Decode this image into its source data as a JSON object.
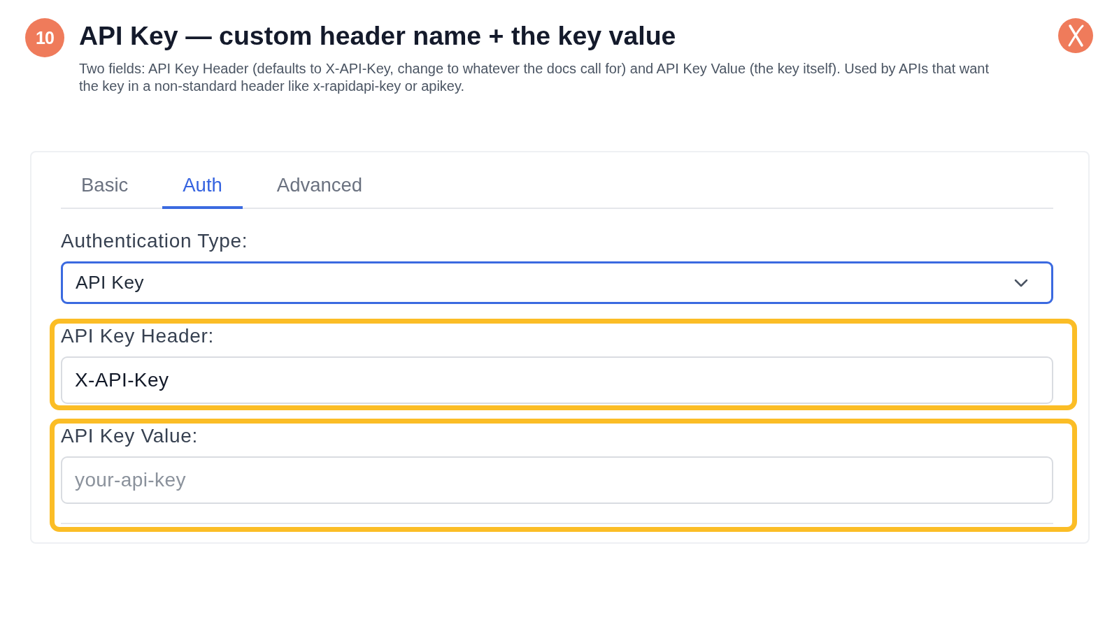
{
  "step_badge": "10",
  "title": "API Key — custom header name + the key value",
  "description": "Two fields: API Key Header (defaults to X-API-Key, change to whatever the docs call for) and API Key Value (the key itself). Used by APIs that want the key in a non-standard header like x-rapidapi-key or apikey.",
  "tabs": [
    {
      "label": "Basic",
      "selected": false
    },
    {
      "label": "Auth",
      "selected": true
    },
    {
      "label": "Advanced",
      "selected": false
    }
  ],
  "fields": [
    {
      "kind": "select",
      "label": "Authentication Type:",
      "value": "API Key",
      "focused": true,
      "highlighted": false
    },
    {
      "kind": "text",
      "label": "API Key Header:",
      "value": "X-API-Key",
      "focused": false,
      "highlighted": true
    },
    {
      "kind": "text",
      "label": "API Key Value:",
      "placeholder": "your-api-key",
      "focused": false,
      "highlighted": true
    }
  ]
}
